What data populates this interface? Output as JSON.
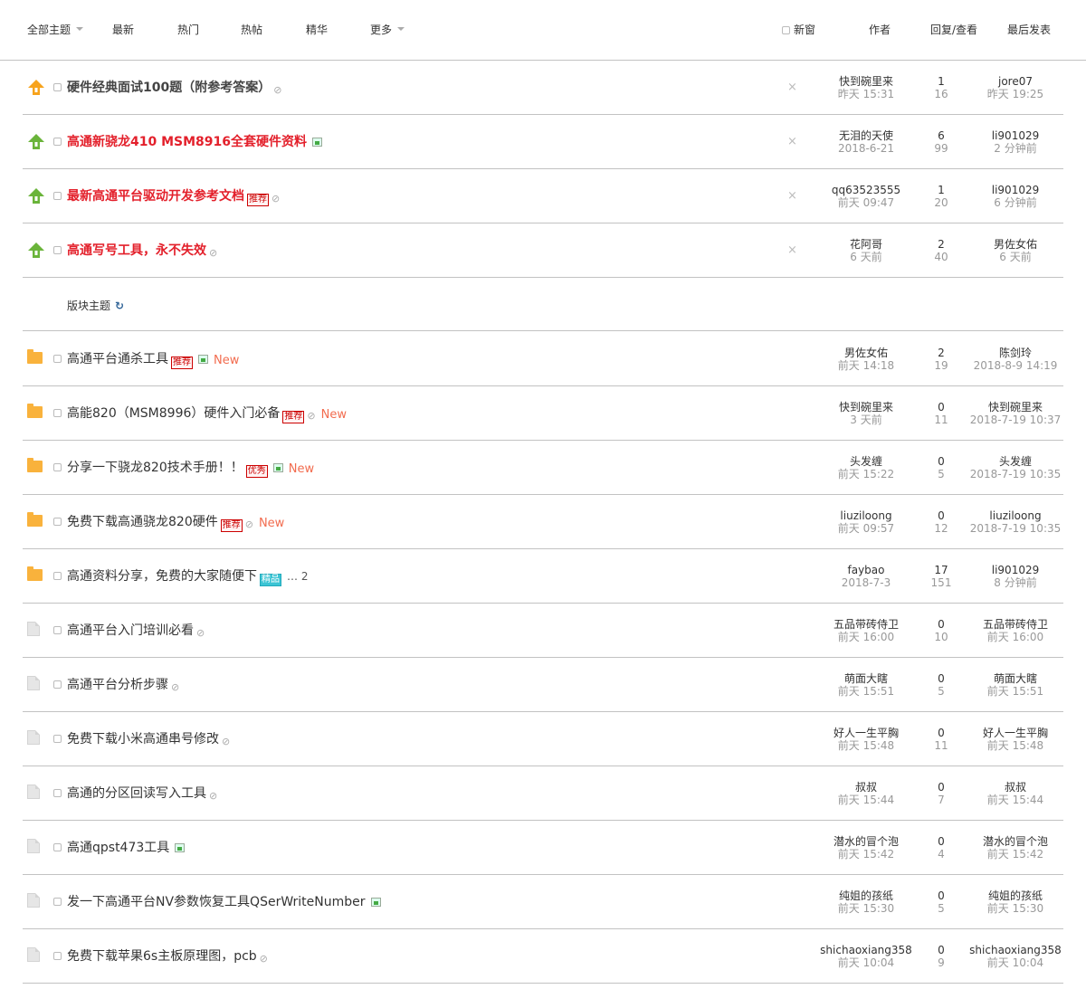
{
  "header": {
    "all": "全部主题",
    "latest": "最新",
    "hot": "热门",
    "hotpost": "热帖",
    "digest": "精华",
    "more": "更多",
    "newwin": "新窗",
    "author": "作者",
    "replies": "回复/查看",
    "lastpost": "最后发表"
  },
  "colors": {
    "pinned_red": "#e3202b",
    "folder": "#f9b23c",
    "new": "#f26c4f"
  },
  "pinned": [
    {
      "icon": "global-top-icon",
      "title": "硬件经典面试100题（附参考答案）",
      "style": "gray",
      "attach": true,
      "author": "快到碗里来",
      "date": "昨天 15:31",
      "replies": "1",
      "views": "16",
      "last_user": "jore07",
      "last_time": "昨天 19:25"
    },
    {
      "icon": "top-icon",
      "title": "高通新骁龙410 MSM8916全套硬件资料",
      "style": "red",
      "img": true,
      "author": "无泪的天使",
      "date": "2018-6-21",
      "replies": "6",
      "views": "99",
      "last_user": "li901029",
      "last_time": "2 分钟前"
    },
    {
      "icon": "top-icon",
      "title": "最新高通平台驱动开发参考文档",
      "style": "red",
      "tag": "推荐",
      "attach": true,
      "author": "qq63523555",
      "date": "前天 09:47",
      "replies": "1",
      "views": "20",
      "last_user": "li901029",
      "last_time": "6 分钟前"
    },
    {
      "icon": "top-icon",
      "title": "高通写号工具，永不失效",
      "style": "red",
      "attach": true,
      "author": "花阿哥",
      "date": "6 天前",
      "replies": "2",
      "views": "40",
      "last_user": "男佐女佑",
      "last_time": "6 天前"
    }
  ],
  "section": {
    "label": "版块主题",
    "refresh": "↻"
  },
  "threads": [
    {
      "icon": "folder",
      "title": "高通平台通杀工具",
      "tag": "推荐",
      "img": true,
      "new": "New",
      "author": "男佐女佑",
      "date": "前天 14:18",
      "replies": "2",
      "views": "19",
      "last_user": "陈剑玲",
      "last_time": "2018-8-9 14:19"
    },
    {
      "icon": "folder",
      "title": "高能820（MSM8996）硬件入门必备",
      "tag": "推荐",
      "attach": true,
      "new": "New",
      "author": "快到碗里来",
      "date": "3 天前",
      "replies": "0",
      "views": "11",
      "last_user": "快到碗里来",
      "last_time": "2018-7-19 10:37"
    },
    {
      "icon": "folder",
      "title": "分享一下骁龙820技术手册！！",
      "tag": "优秀",
      "img": true,
      "new": "New",
      "author": "头发缠",
      "date": "前天 15:22",
      "replies": "0",
      "views": "5",
      "last_user": "头发缠",
      "last_time": "2018-7-19 10:35"
    },
    {
      "icon": "folder",
      "title": "免费下载高通骁龙820硬件",
      "tag": "推荐",
      "attach": true,
      "new": "New",
      "author": "liuziloong",
      "date": "前天 09:57",
      "replies": "0",
      "views": "12",
      "last_user": "liuziloong",
      "last_time": "2018-7-19 10:35"
    },
    {
      "icon": "folder",
      "title": "高通资料分享，免费的大家随便下",
      "jing": "精品",
      "pages": "… 2",
      "author": "faybao",
      "date": "2018-7-3",
      "replies": "17",
      "views": "151",
      "last_user": "li901029",
      "last_time": "8 分钟前"
    },
    {
      "icon": "file",
      "title": "高通平台入门培训必看",
      "attach": true,
      "author": "五品带砖侍卫",
      "date": "前天 16:00",
      "replies": "0",
      "views": "10",
      "last_user": "五品带砖侍卫",
      "last_time": "前天 16:00"
    },
    {
      "icon": "file",
      "title": "高通平台分析步骤",
      "attach": true,
      "author": "萌面大瞎",
      "date": "前天 15:51",
      "replies": "0",
      "views": "5",
      "last_user": "萌面大瞎",
      "last_time": "前天 15:51"
    },
    {
      "icon": "file",
      "title": "免费下载小米高通串号修改",
      "attach": true,
      "author": "好人一生平胸",
      "date": "前天 15:48",
      "replies": "0",
      "views": "11",
      "last_user": "好人一生平胸",
      "last_time": "前天 15:48"
    },
    {
      "icon": "file",
      "title": "高通的分区回读写入工具",
      "attach": true,
      "author": "叔叔",
      "date": "前天 15:44",
      "replies": "0",
      "views": "7",
      "last_user": "叔叔",
      "last_time": "前天 15:44"
    },
    {
      "icon": "file",
      "title": "高通qpst473工具",
      "img": true,
      "author": "潜水的冒个泡",
      "date": "前天 15:42",
      "replies": "0",
      "views": "4",
      "last_user": "潜水的冒个泡",
      "last_time": "前天 15:42"
    },
    {
      "icon": "file",
      "title": "发一下高通平台NV参数恢复工具QSerWriteNumber",
      "img": true,
      "author": "纯姐的孩纸",
      "date": "前天 15:30",
      "replies": "0",
      "views": "5",
      "last_user": "纯姐的孩纸",
      "last_time": "前天 15:30"
    },
    {
      "icon": "file",
      "title": "免费下载苹果6s主板原理图，pcb",
      "attach": true,
      "author": "shichaoxiang358",
      "date": "前天 10:04",
      "replies": "0",
      "views": "9",
      "last_user": "shichaoxiang358",
      "last_time": "前天 10:04"
    }
  ]
}
